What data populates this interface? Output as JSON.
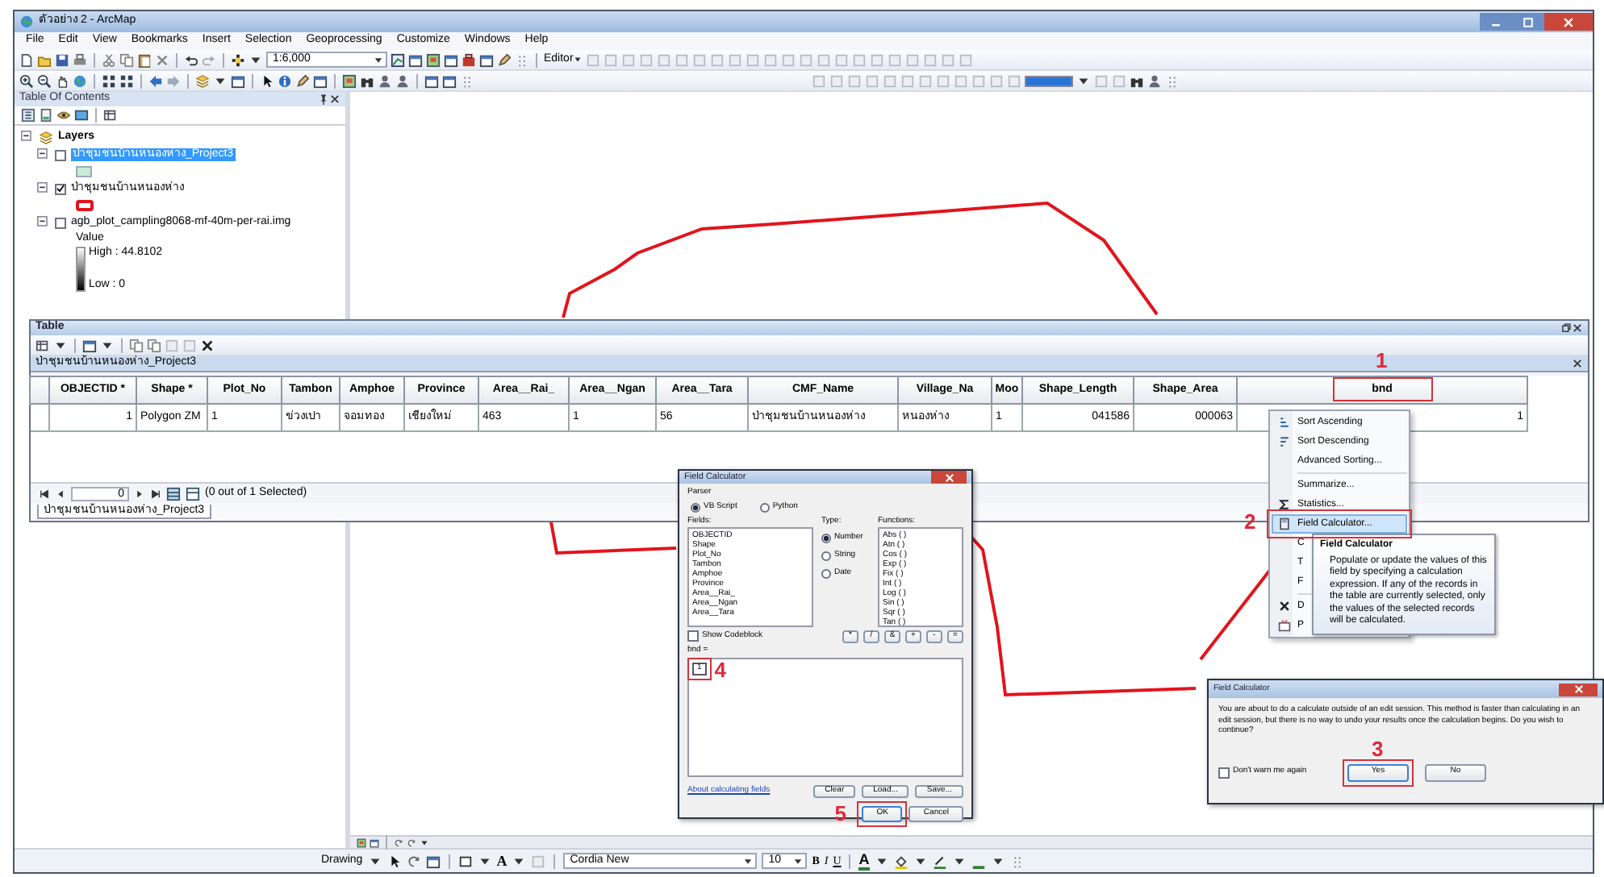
{
  "window": {
    "title": "ตัวอย่าง 2 - ArcMap"
  },
  "menu": [
    "File",
    "Edit",
    "View",
    "Bookmarks",
    "Insert",
    "Selection",
    "Geoprocessing",
    "Customize",
    "Windows",
    "Help"
  ],
  "toolbar": {
    "scale": "1:6,000",
    "editor": "Editor"
  },
  "toc": {
    "title": "Table Of Contents",
    "root": {
      "label": "Layers",
      "expanded": true,
      "children": [
        {
          "label": "ป่าชุมชนบ้านหนองห่าง_Project3",
          "checked": false,
          "selected": true,
          "kind": "fill",
          "color": "#c8ecd8"
        },
        {
          "label": "ป่าชุมชนบ้านหนองห่าง",
          "checked": true,
          "selected": false,
          "kind": "outline",
          "color": "#e0141e"
        },
        {
          "label": "agb_plot_campling8068-mf-40m-per-rai.img",
          "checked": false,
          "selected": false,
          "kind": "raster",
          "legend_title": "Value",
          "high": "High : 44.8102",
          "low": "Low : 0"
        }
      ]
    }
  },
  "table": {
    "title": "Table",
    "tab": "ป่าชุมชนบ้านหนองห่าง_Project3",
    "columns": [
      "OBJECTID *",
      "Shape *",
      "Plot_No",
      "Tambon",
      "Amphoe",
      "Province",
      "Area__Rai_",
      "Area__Ngan",
      "Area__Tara",
      "CMF_Name",
      "Village_Na",
      "Moo",
      "Shape_Length",
      "Shape_Area",
      "bnd"
    ],
    "rows": [
      [
        "1",
        "Polygon ZM",
        "1",
        "ข่วงเปา",
        "จอมทอง",
        "เชียงใหม่",
        "463",
        "1",
        "56",
        "ป่าชุมชนบ้านหนองห่าง",
        "หนองห่าง",
        "1",
        "041586",
        "000063",
        "1"
      ]
    ],
    "record": "0",
    "status": "(0 out of 1 Selected)",
    "bottom_tab": "ป่าชุมชนบ้านหนองห่าง_Project3"
  },
  "context_menu": [
    {
      "kind": "item",
      "label": "Sort Ascending",
      "selected": false
    },
    {
      "kind": "item",
      "label": "Sort Descending",
      "selected": false
    },
    {
      "kind": "item",
      "label": "Advanced Sorting...",
      "selected": false
    },
    {
      "kind": "separator"
    },
    {
      "kind": "item",
      "label": "Summarize...",
      "selected": false
    },
    {
      "kind": "item",
      "label": "Statistics...",
      "selected": false
    },
    {
      "kind": "item",
      "label": "Field Calculator...",
      "selected": true
    },
    {
      "kind": "item",
      "label": "C",
      "selected": false
    },
    {
      "kind": "item",
      "label": "T",
      "selected": false
    },
    {
      "kind": "item",
      "label": "F",
      "selected": false
    },
    {
      "kind": "separator"
    },
    {
      "kind": "item",
      "label": "D",
      "selected": false
    },
    {
      "kind": "item",
      "label": "P",
      "selected": false
    }
  ],
  "tooltip": {
    "title": "Field Calculator",
    "text": "Populate or update the values of this field by specifying a calculation expression. If any of the records in the table are currently selected, only the values of the selected records will be calculated."
  },
  "field_calculator": {
    "title": "Field Calculator",
    "parser_label": "Parser",
    "parsers": [
      {
        "label": "VB Script",
        "selected": true
      },
      {
        "label": "Python",
        "selected": false
      }
    ],
    "fields_label": "Fields:",
    "fields": [
      "OBJECTID",
      "Shape",
      "Plot_No",
      "Tambon",
      "Amphoe",
      "Province",
      "Area__Rai_",
      "Area__Ngan",
      "Area__Tara"
    ],
    "type_label": "Type:",
    "types": [
      {
        "label": "Number",
        "selected": true
      },
      {
        "label": "String",
        "selected": false
      },
      {
        "label": "Date",
        "selected": false
      }
    ],
    "functions_label": "Functions:",
    "functions": [
      "Abs ( )",
      "Atn ( )",
      "Cos ( )",
      "Exp ( )",
      "Fix ( )",
      "Int ( )",
      "Log ( )",
      "Sin ( )",
      "Sqr ( )",
      "Tan ( )"
    ],
    "codeblock": {
      "label": "Show Codeblock",
      "checked": false
    },
    "operators": [
      "*",
      "/",
      "&",
      "+",
      "-",
      "="
    ],
    "expression_label": "bnd =",
    "expression": "1",
    "help_link": "About calculating fields",
    "tools": [
      "Clear",
      "Load...",
      "Save..."
    ],
    "buttons": [
      "OK",
      "Cancel"
    ]
  },
  "confirm": {
    "title": "Field Calculator",
    "message": "You are about to do a calculate outside of an edit session. This method is faster than calculating in an edit session, but there is no way to undo your results once the calculation begins. Do you wish to continue?",
    "dont_warn": {
      "label": "Don't warn me again",
      "checked": false
    },
    "buttons": [
      "Yes",
      "No"
    ]
  },
  "drawing_toolbar": {
    "menu": "Drawing",
    "text_tool": "A",
    "font": "Cordia New",
    "size": "10",
    "styles": [
      "B",
      "I",
      "U"
    ],
    "colors": [
      "A"
    ]
  },
  "annotations": [
    "1",
    "2",
    "3",
    "4",
    "5"
  ]
}
